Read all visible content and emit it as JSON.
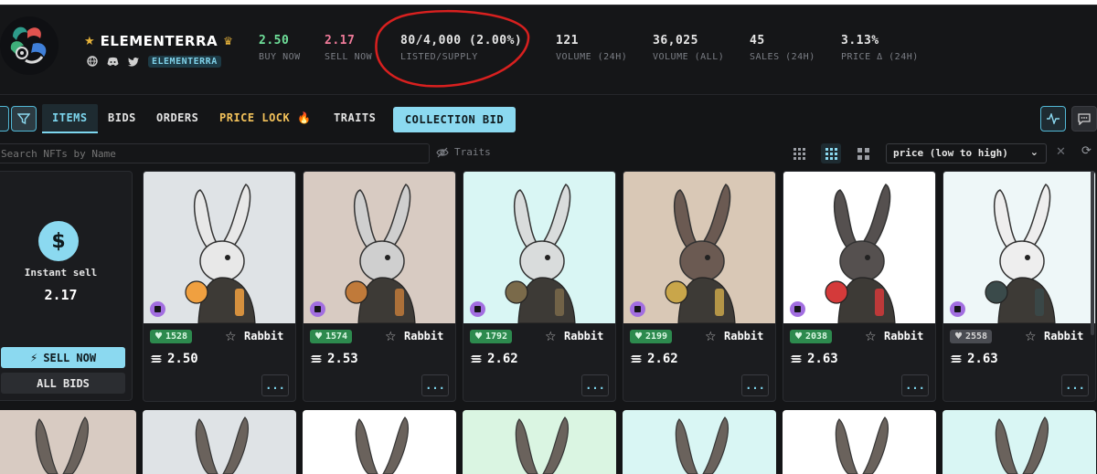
{
  "collection": {
    "name": "ELEMENTERRA",
    "tag": "ELEMENTERRA"
  },
  "stats": [
    {
      "value": "2.50",
      "label": "BUY NOW",
      "color": "#6fe09a"
    },
    {
      "value": "2.17",
      "label": "SELL NOW",
      "color": "#f07b9a"
    },
    {
      "value": "80/4,000 (2.00%)",
      "label": "LISTED/SUPPLY",
      "color": "#e6e6e6"
    },
    {
      "value": "121",
      "label": "VOLUME (24H)",
      "color": "#e6e6e6"
    },
    {
      "value": "36,025",
      "label": "VOLUME (ALL)",
      "color": "#e6e6e6"
    },
    {
      "value": "45",
      "label": "SALES (24H)",
      "color": "#e6e6e6"
    },
    {
      "value": "3.13%",
      "label": "PRICE Δ (24H)",
      "color": "#e6e6e6"
    }
  ],
  "tabs": {
    "items": "ITEMS",
    "bids": "BIDS",
    "orders": "ORDERS",
    "price_lock": "PRICE LOCK",
    "traits": "TRAITS",
    "collection_bid": "COLLECTION BID"
  },
  "search": {
    "placeholder": "Search NFTs by Name",
    "traits_label": "Traits",
    "sort_value": "price (low to high)"
  },
  "sell_panel": {
    "label": "Instant sell",
    "value": "2.17",
    "sell_now": "SELL NOW",
    "all_bids": "ALL BIDS"
  },
  "cards": [
    {
      "likes": "1528",
      "type": "Rabbit",
      "price": "2.50",
      "bg": "#dfe3e6",
      "fur": "#e8e8e8",
      "accent": "#f0a040"
    },
    {
      "likes": "1574",
      "type": "Rabbit",
      "price": "2.53",
      "bg": "#d8cbc2",
      "fur": "#cfcfcf",
      "accent": "#c07a3a"
    },
    {
      "likes": "1792",
      "type": "Rabbit",
      "price": "2.62",
      "bg": "#d9f6f4",
      "fur": "#d9dcdc",
      "accent": "#7a6a4a"
    },
    {
      "likes": "2199",
      "type": "Rabbit",
      "price": "2.62",
      "bg": "#d9c8b6",
      "fur": "#6b5a52",
      "accent": "#c9a64a"
    },
    {
      "likes": "2038",
      "type": "Rabbit",
      "price": "2.63",
      "bg": "#ffffff",
      "fur": "#55504f",
      "accent": "#d43a3a"
    },
    {
      "likes": "2558",
      "type": "Rabbit",
      "price": "2.63",
      "bg": "#eef7f8",
      "fur": "#eeeeee",
      "accent": "#3a4a4a",
      "grey": true
    }
  ],
  "row2_bgs": [
    "#d8cbc2",
    "#dfe3e6",
    "#ffffff",
    "#daf5e2",
    "#d9f6f4",
    "#ffffff",
    "#d9f6f4"
  ],
  "more_label": "..."
}
